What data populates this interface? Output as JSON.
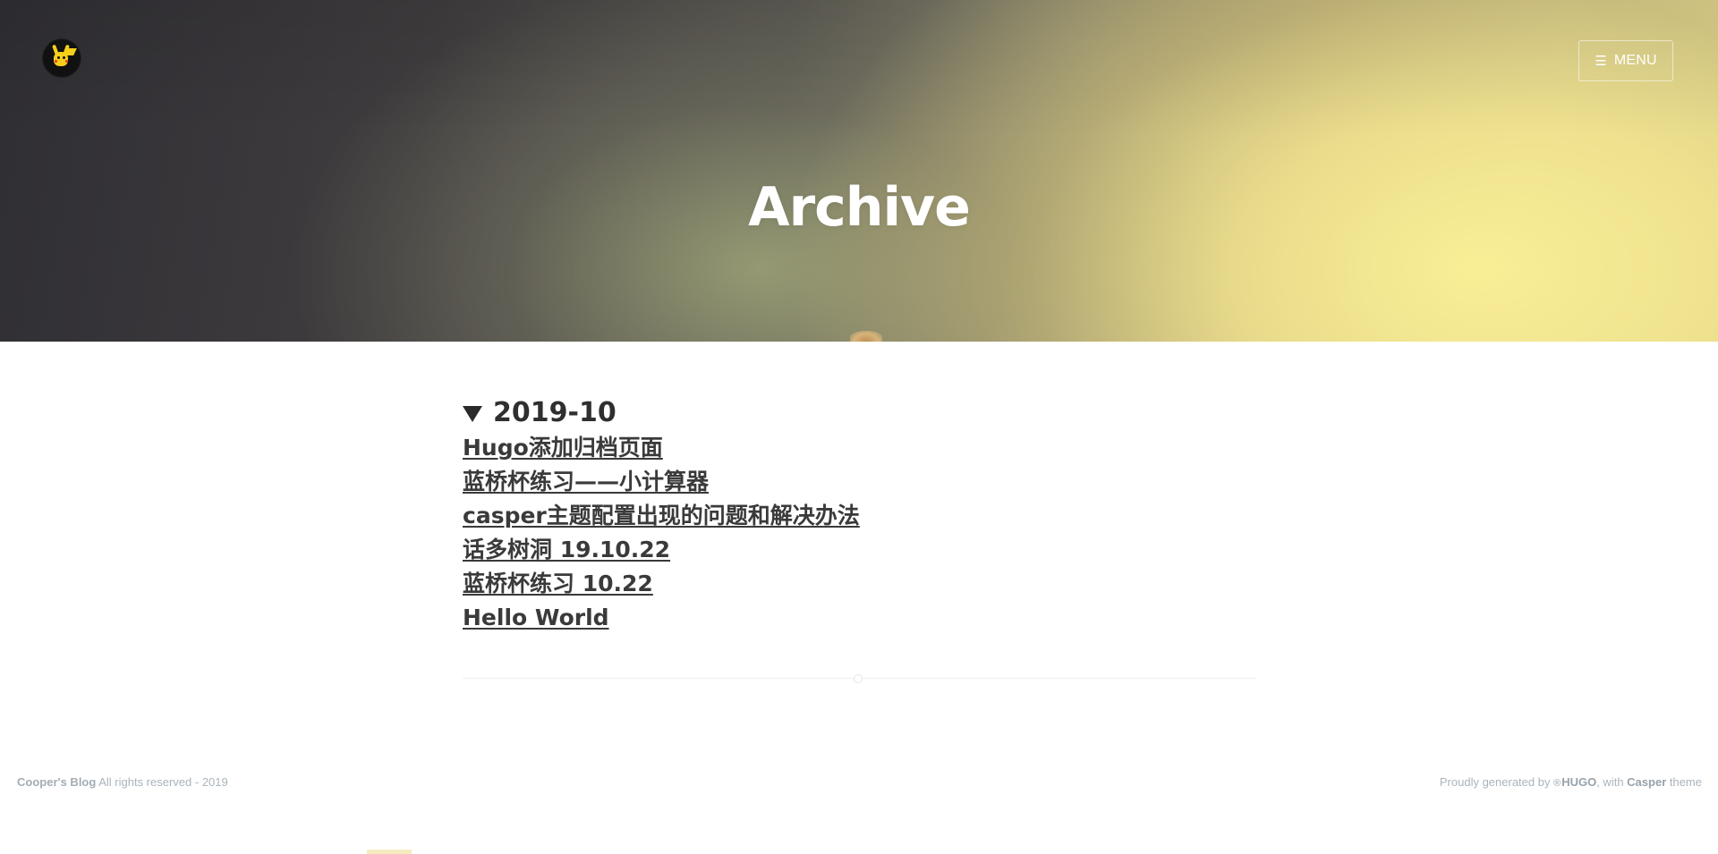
{
  "header": {
    "title": "Archive",
    "menu_label": "MENU",
    "menu_icon": "☰",
    "logo_icon": "pikachu-logo-icon"
  },
  "archive": {
    "groups": [
      {
        "month": "2019-10",
        "posts": [
          "Hugo添加归档页面",
          "蓝桥杯练习——小计算器",
          "casper主题配置出现的问题和解决办法",
          "话多树洞 19.10.22",
          "蓝桥杯练习 10.22",
          "Hello World"
        ]
      }
    ]
  },
  "footer": {
    "site_name": "Cooper's Blog",
    "rights": " All rights reserved - 2019",
    "generated_prefix": "Proudly generated by ",
    "hugo_label": "HUGO",
    "with_text": ", with ",
    "theme_name": "Casper",
    "theme_suffix": " theme"
  },
  "colors": {
    "title_text": "#ffffff",
    "post_link": "#3a3a3a",
    "footer_text": "#aab4bc"
  }
}
